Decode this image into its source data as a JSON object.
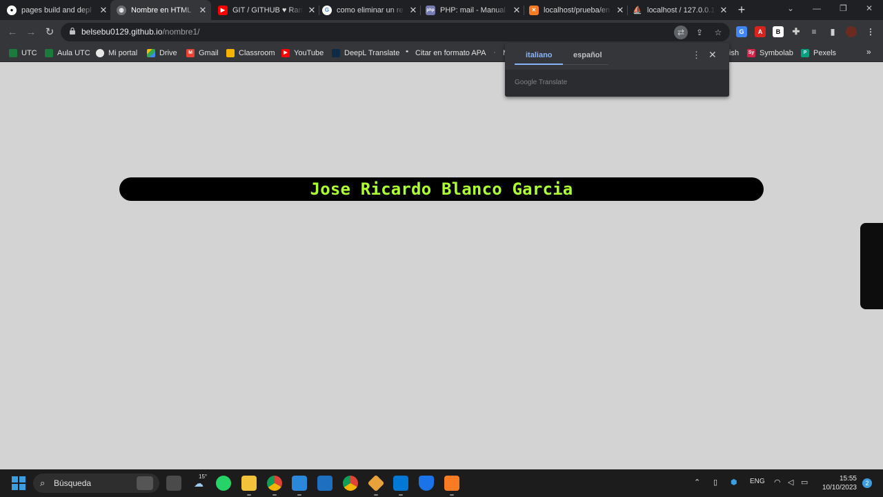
{
  "browser": {
    "tabs": [
      {
        "title": "pages build and depl",
        "active": false,
        "icon": "github-icon"
      },
      {
        "title": "Nombre en HTML",
        "active": true,
        "icon": "globe-icon"
      },
      {
        "title": "GIT / GITHUB ♥ Ram",
        "active": false,
        "icon": "youtube-icon"
      },
      {
        "title": "como eliminar un re",
        "active": false,
        "icon": "google-icon"
      },
      {
        "title": "PHP: mail - Manual",
        "active": false,
        "icon": "php-icon"
      },
      {
        "title": "localhost/prueba/en",
        "active": false,
        "icon": "xampp-icon"
      },
      {
        "title": "localhost / 127.0.0.1",
        "active": false,
        "icon": "phpmyadmin-icon"
      }
    ],
    "address": {
      "host": "belsebu0129.github.io",
      "path": "/nombre1/"
    },
    "bookmarks": [
      {
        "label": "UTC"
      },
      {
        "label": "Aula UTC"
      },
      {
        "label": "Mi portal"
      },
      {
        "label": "Drive"
      },
      {
        "label": "Gmail"
      },
      {
        "label": "Classroom"
      },
      {
        "label": "YouTube"
      },
      {
        "label": "DeepL Translate"
      },
      {
        "label": "Citar en formato APA"
      },
      {
        "label": "M"
      },
      {
        "label": "ish"
      },
      {
        "label": "Symbolab"
      },
      {
        "label": "Pexels"
      }
    ],
    "more_bookmarks": "»"
  },
  "translate_popup": {
    "source_lang": "italiano",
    "target_lang": "español",
    "footer": "Google Translate"
  },
  "page": {
    "name": "Jose Ricardo Blanco Garcia"
  },
  "taskbar": {
    "search_placeholder": "Búsqueda",
    "weather": "15°",
    "language": "ENG",
    "time": "15:55",
    "date": "10/10/2023",
    "notification_count": "2"
  },
  "colors": {
    "page_bg": "#d3d3d3",
    "name_bar_bg": "#000000",
    "name_text": "#adff2f",
    "accent": "#8ab4f8"
  }
}
